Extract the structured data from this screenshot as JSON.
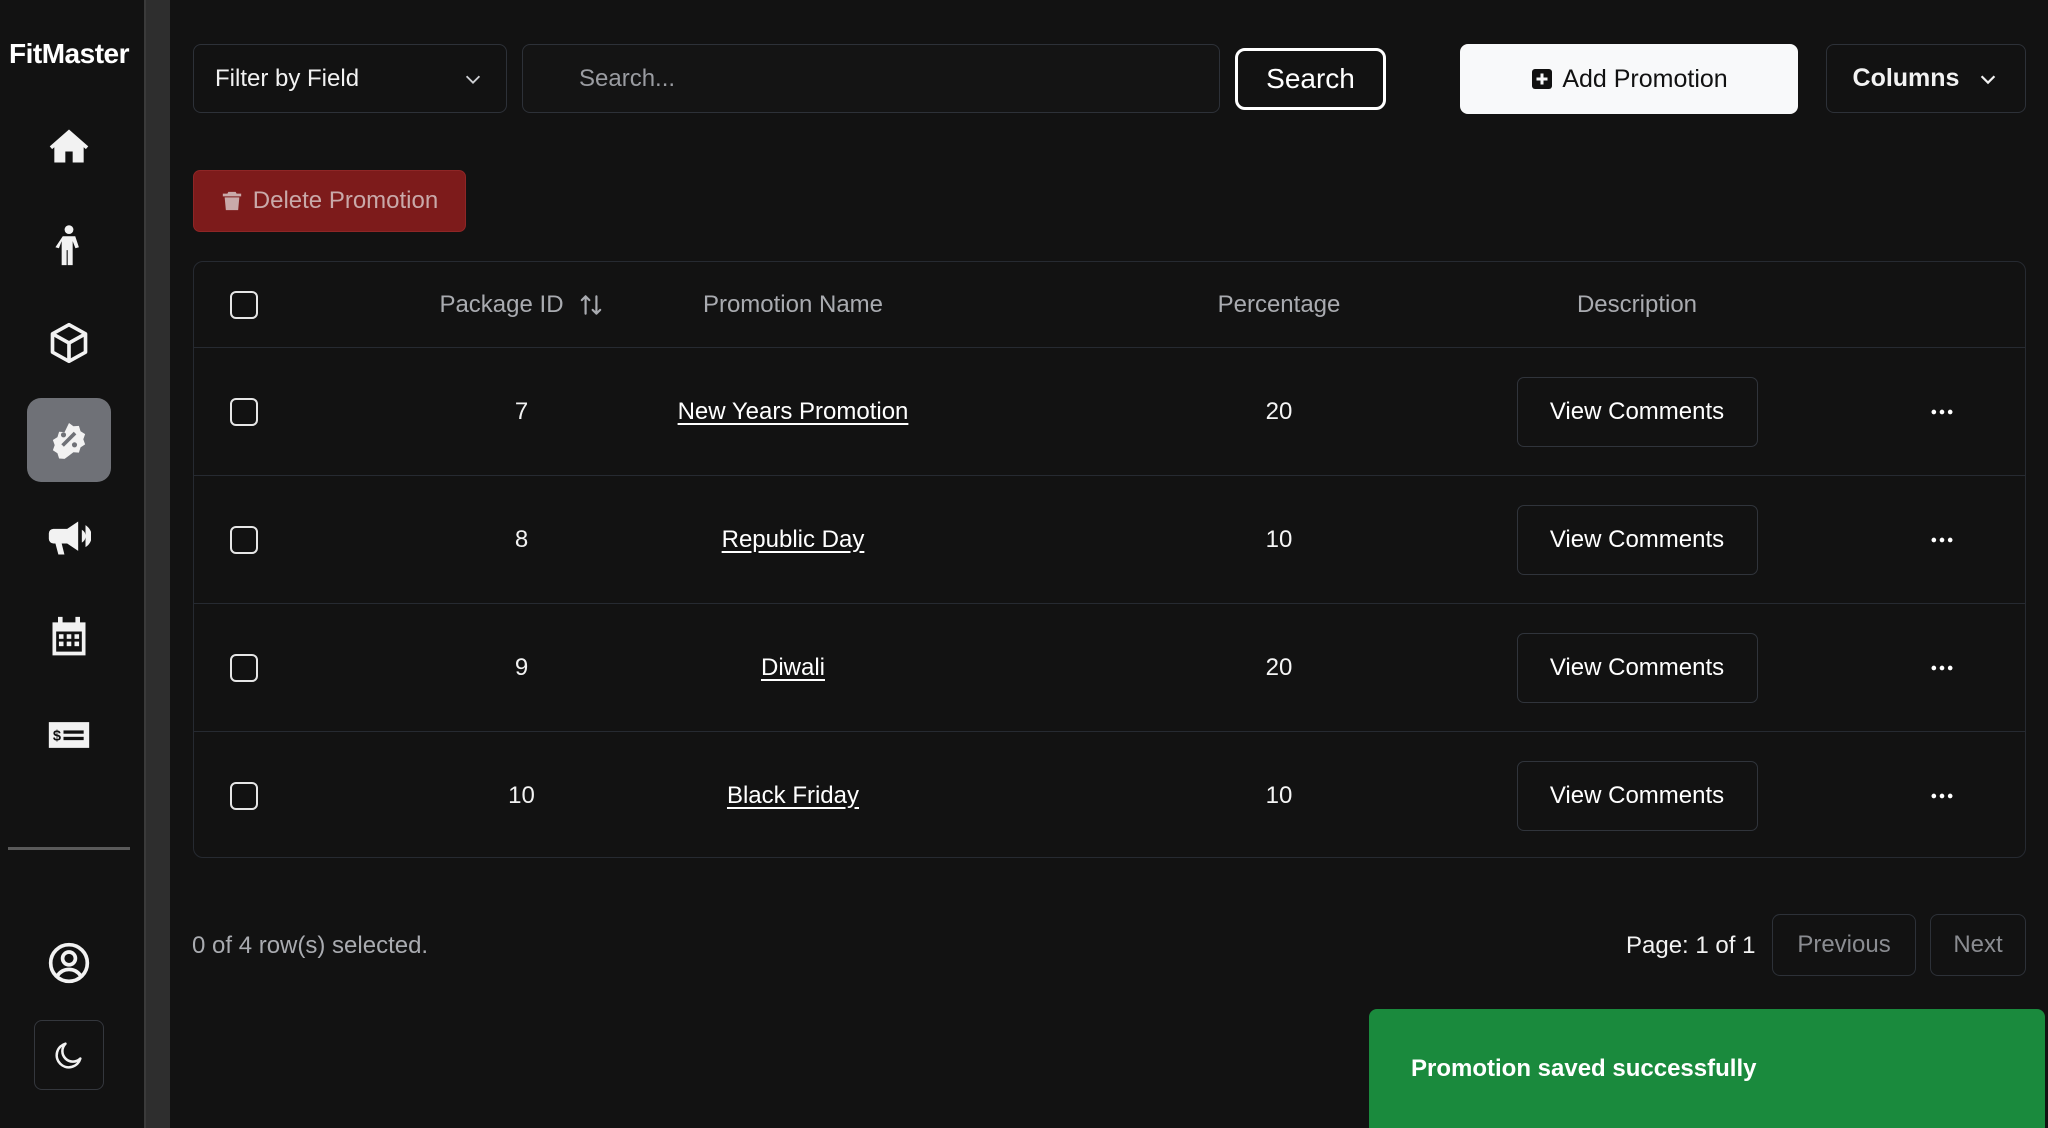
{
  "app": {
    "brand": "FitMaster"
  },
  "sidebar": {
    "items": [
      {
        "name": "home",
        "icon": "home-icon"
      },
      {
        "name": "members",
        "icon": "person-icon"
      },
      {
        "name": "packages",
        "icon": "box-icon"
      },
      {
        "name": "promotions",
        "icon": "discount-badge-icon",
        "active": true
      },
      {
        "name": "announcements",
        "icon": "megaphone-icon"
      },
      {
        "name": "schedule",
        "icon": "calendar-icon"
      },
      {
        "name": "billing",
        "icon": "money-check-icon"
      }
    ],
    "profile_icon": "user-circle-icon",
    "theme_icon": "moon-icon"
  },
  "toolbar": {
    "filter_label": "Filter by Field",
    "search_placeholder": "Search...",
    "search_value": "",
    "search_button": "Search",
    "add_button": "Add Promotion",
    "columns_button": "Columns",
    "delete_button": "Delete Promotion"
  },
  "table": {
    "columns": [
      "Package ID",
      "Promotion Name",
      "Percentage",
      "Description"
    ],
    "rows": [
      {
        "id": "7",
        "name": "New Years Promotion",
        "percentage": "20",
        "description_action": "View Comments"
      },
      {
        "id": "8",
        "name": "Republic Day",
        "percentage": "10",
        "description_action": "View Comments"
      },
      {
        "id": "9",
        "name": "Diwali",
        "percentage": "20",
        "description_action": "View Comments"
      },
      {
        "id": "10",
        "name": "Black Friday",
        "percentage": "10",
        "description_action": "View Comments"
      }
    ]
  },
  "footer": {
    "selected_text": "0 of 4 row(s) selected.",
    "page_info": "Page: 1 of 1",
    "previous": "Previous",
    "next": "Next"
  },
  "toast": {
    "message": "Promotion saved successfully"
  },
  "colors": {
    "background": "#121212",
    "active_nav": "#6f7177",
    "delete": "#7d1b1b",
    "toast": "#1a8a3d"
  }
}
